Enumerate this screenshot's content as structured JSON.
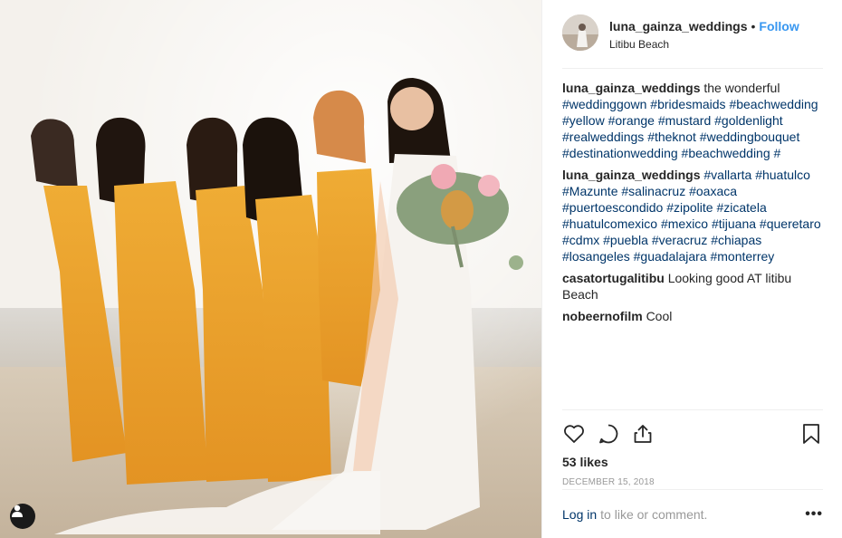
{
  "post": {
    "username": "luna_gainza_weddings",
    "follow_label": "Follow",
    "separator": "•",
    "location": "Litibu Beach"
  },
  "comments": [
    {
      "author": "luna_gainza_weddings",
      "text": "the wonderful",
      "tags": [
        "#weddinggown",
        "#bridesmaids",
        "#beachwedding",
        "#yellow",
        "#orange",
        "#mustard",
        "#goldenlight",
        "#realweddings",
        "#theknot",
        "#weddingbouquet",
        "#destinationwedding",
        "#beachwedding",
        "#"
      ]
    },
    {
      "author": "luna_gainza_weddings",
      "text": "",
      "tags": [
        "#vallarta",
        "#huatulco",
        "#Mazunte",
        "#salinacruz",
        "#oaxaca",
        "#puertoescondido",
        "#zipolite",
        "#zicatela",
        "#huatulcomexico",
        "#mexico",
        "#tijuana",
        "#queretaro",
        "#cdmx",
        "#puebla",
        "#veracruz",
        "#chiapas",
        "#losangeles",
        "#guadalajara",
        "#monterrey"
      ]
    },
    {
      "author": "casatortugalitibu",
      "text": "Looking good AT litibu Beach",
      "tags": []
    },
    {
      "author": "nobeernofilm",
      "text": "Cool",
      "tags": []
    }
  ],
  "actions": {
    "icons": [
      "heart-icon",
      "comment-icon",
      "share-icon",
      "bookmark-icon"
    ]
  },
  "likes": "53 likes",
  "date": "DECEMBER 15, 2018",
  "login": {
    "link": "Log in",
    "rest": "to like or comment.",
    "more": "•••"
  },
  "colors": {
    "link_blue": "#3897f0",
    "hashtag": "#003569",
    "muted": "#999999",
    "dress": "#e9a12c"
  }
}
